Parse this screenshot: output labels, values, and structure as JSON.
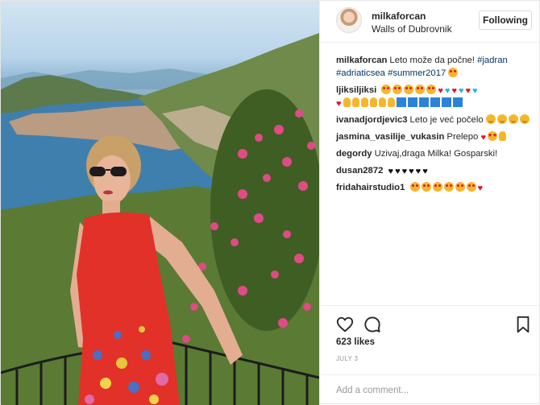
{
  "post": {
    "username": "milkaforcan",
    "location": "Walls of Dubrovnik",
    "follow_label": "Following",
    "likes": "623 likes",
    "date": "JULY 3",
    "add_comment_placeholder": "Add a comment..."
  },
  "caption": {
    "username": "milkaforcan",
    "text": "Leto može da počne!",
    "hashtags": [
      "#jadran",
      "#adriaticsea",
      "#summer2017"
    ]
  },
  "comments": [
    {
      "username": "ljiksiljiksi",
      "text": ""
    },
    {
      "username": "ivanadjordjevic3",
      "text": "Leto je već počelo"
    },
    {
      "username": "jasmina_vasilije_vukasin",
      "text": "Prelepo"
    },
    {
      "username": "degordy",
      "text": "Uzivaj,draga Milka! Gosparski!"
    },
    {
      "username": "dusan2872",
      "text": ""
    },
    {
      "username": "fridahairstudio1",
      "text": ""
    }
  ],
  "icons": {
    "like": "heart-outline-icon",
    "comment": "speech-bubble-icon",
    "save": "bookmark-icon"
  },
  "colors": {
    "hashtag": "#003569",
    "border": "#efefef",
    "muted": "#999999"
  }
}
